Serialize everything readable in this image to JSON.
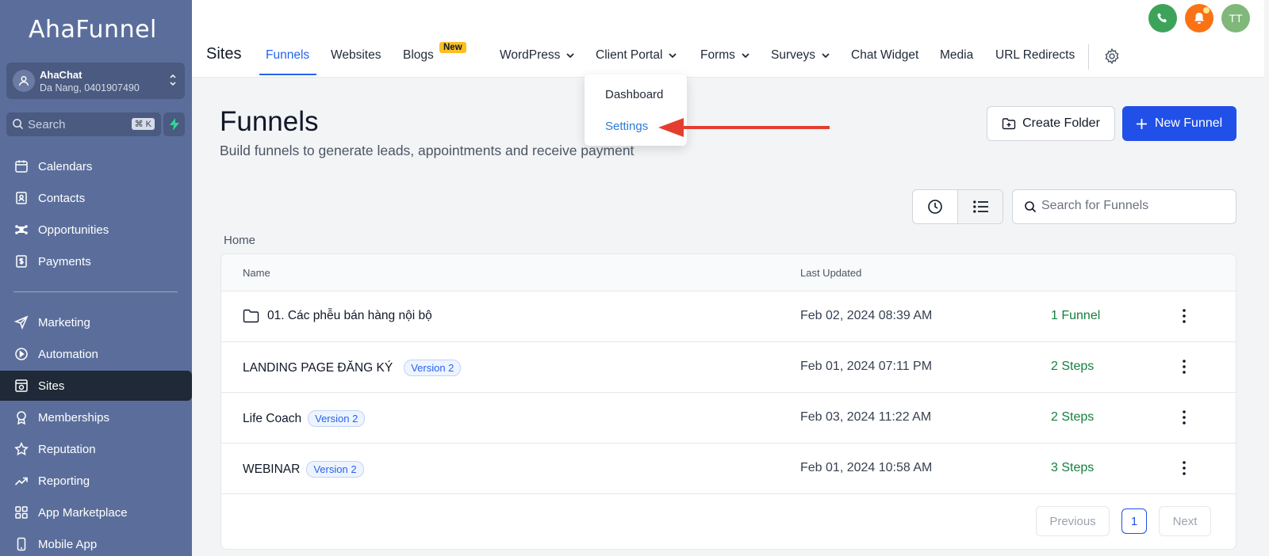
{
  "sidebar": {
    "logo": "AhaFunnel",
    "account": {
      "name": "AhaChat",
      "subtitle": "Da Nang, 0401907490"
    },
    "search": {
      "placeholder": "Search",
      "shortcut": "⌘ K"
    },
    "items": [
      {
        "label": "Calendars",
        "icon": "calendar-icon"
      },
      {
        "label": "Contacts",
        "icon": "contacts-icon"
      },
      {
        "label": "Opportunities",
        "icon": "opportunities-icon"
      },
      {
        "label": "Payments",
        "icon": "payments-icon"
      },
      {
        "label": "Marketing",
        "icon": "send-icon"
      },
      {
        "label": "Automation",
        "icon": "automation-icon"
      },
      {
        "label": "Sites",
        "icon": "sites-icon",
        "active": true
      },
      {
        "label": "Memberships",
        "icon": "badge-icon"
      },
      {
        "label": "Reputation",
        "icon": "star-icon"
      },
      {
        "label": "Reporting",
        "icon": "trend-icon"
      },
      {
        "label": "App Marketplace",
        "icon": "grid-icon"
      },
      {
        "label": "Mobile App",
        "icon": "phone-icon"
      }
    ]
  },
  "topbar": {
    "section": "Sites",
    "tabs": [
      "Funnels",
      "Websites",
      "Blogs",
      "WordPress",
      "Client Portal",
      "Forms",
      "Surveys",
      "Chat Widget",
      "Media",
      "URL Redirects"
    ],
    "new_badge": "New",
    "avatar_initials": "TT"
  },
  "dropdown": {
    "items": [
      "Dashboard",
      "Settings"
    ]
  },
  "main": {
    "title": "Funnels",
    "subtitle": "Build funnels to generate leads, appointments and receive payment",
    "create_folder": "Create Folder",
    "new_funnel": "New Funnel",
    "search_placeholder": "Search for Funnels",
    "breadcrumb": "Home",
    "columns": {
      "name": "Name",
      "updated": "Last Updated"
    },
    "rows": [
      {
        "name": "01. Các phễu bán hàng nội bộ",
        "folder": true,
        "version": "",
        "updated": "Feb 02, 2024 08:39 AM",
        "count": "1 Funnel"
      },
      {
        "name": "LANDING PAGE ĐĂNG KÝ",
        "folder": false,
        "version": "Version 2",
        "updated": "Feb 01, 2024 07:11 PM",
        "count": "2 Steps"
      },
      {
        "name": "Life Coach",
        "folder": false,
        "version": "Version 2",
        "updated": "Feb 03, 2024 11:22 AM",
        "count": "2 Steps"
      },
      {
        "name": "WEBINAR",
        "folder": false,
        "version": "Version 2",
        "updated": "Feb 01, 2024 10:58 AM",
        "count": "3 Steps"
      }
    ],
    "pagination": {
      "previous": "Previous",
      "page": "1",
      "next": "Next"
    }
  },
  "colors": {
    "sidebar": "#5b6e9b",
    "accent": "#2150e8",
    "active_nav": "#1f2937",
    "success": "#15803d",
    "annotation_arrow": "#e53e2e"
  }
}
